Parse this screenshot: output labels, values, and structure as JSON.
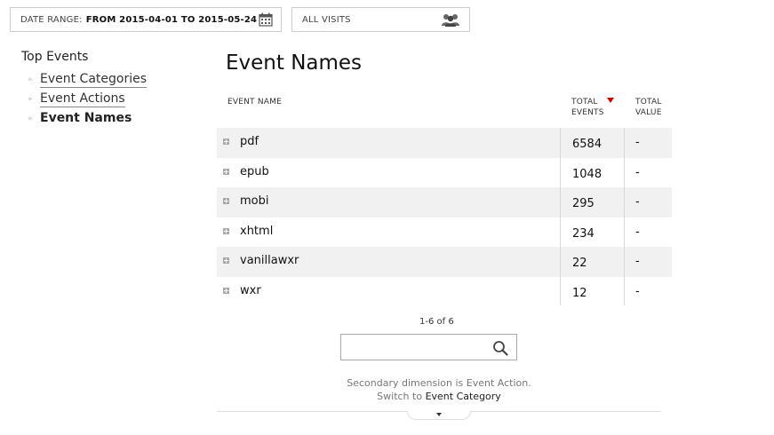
{
  "filters": {
    "date_range_label": "DATE RANGE:",
    "date_range_value": "FROM 2015-04-01 TO 2015-05-24",
    "segment_label": "ALL VISITS"
  },
  "sidebar": {
    "title": "Top Events",
    "items": [
      {
        "label": "Event Categories",
        "active": false
      },
      {
        "label": "Event Actions",
        "active": false
      },
      {
        "label": "Event Names",
        "active": true
      }
    ]
  },
  "report": {
    "title": "Event Names",
    "columns": {
      "name": "EVENT NAME",
      "events_line1": "TOTAL",
      "events_line2": "EVENTS",
      "value_line1": "TOTAL",
      "value_line2": "VALUE"
    },
    "rows": [
      {
        "name": "pdf",
        "events": "6584",
        "value": "-"
      },
      {
        "name": "epub",
        "events": "1048",
        "value": "-"
      },
      {
        "name": "mobi",
        "events": "295",
        "value": "-"
      },
      {
        "name": "xhtml",
        "events": "234",
        "value": "-"
      },
      {
        "name": "vanillawxr",
        "events": "22",
        "value": "-"
      },
      {
        "name": "wxr",
        "events": "12",
        "value": "-"
      }
    ],
    "pagination": "1-6 of 6",
    "search": {
      "placeholder": "",
      "value": ""
    },
    "secondary_note": "Secondary dimension is Event Action.",
    "switch_prefix": "Switch to ",
    "switch_link": "Event Category"
  },
  "icons": {
    "calendar": "calendar-icon",
    "segment": "people-icon",
    "search": "search-icon",
    "sort": "sort-desc-icon",
    "expand": "expand-row-icon"
  },
  "colors": {
    "sort_indicator": "#cc0000",
    "row_stripe": "#f1f1f1"
  }
}
